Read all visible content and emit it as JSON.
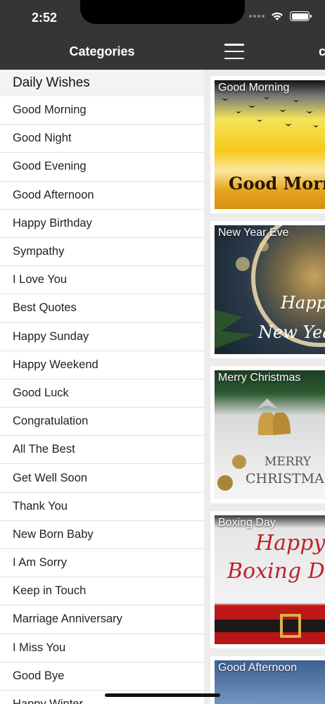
{
  "status_bar": {
    "time": "2:52"
  },
  "sidebar": {
    "title": "Categories",
    "section": "Daily Wishes",
    "items": [
      "Good Morning",
      "Good Night",
      "Good Evening",
      "Good Afternoon",
      "Happy Birthday",
      "Sympathy",
      "I Love You",
      "Best Quotes",
      "Happy Sunday",
      "Happy Weekend",
      "Good Luck",
      "Congratulation",
      "All The Best",
      "Get Well Soon",
      "Thank You",
      "New Born Baby",
      "I Am Sorry",
      "Keep in Touch",
      "Marriage Anniversary",
      "I Miss You",
      "Good Bye",
      "Happy Winter"
    ]
  },
  "main": {
    "header_partial": "c",
    "cards": [
      {
        "title": "Good Morning",
        "caption": "Good Mornin"
      },
      {
        "title": "New Year Eve",
        "caption_line1": "Happy",
        "caption_line2": "New Year"
      },
      {
        "title": "Merry Christmas",
        "caption_line1": "MERRY",
        "caption_line2": "CHRISTMAS"
      },
      {
        "title": "Boxing Day",
        "caption_line1": "Happy",
        "caption_line2": "Boxing Da"
      },
      {
        "title": "Good Afternoon"
      }
    ]
  },
  "colors": {
    "header_bg": "#353535",
    "list_bg": "#ffffff",
    "section_bg": "#f3f3f3",
    "content_bg": "#ececec"
  }
}
